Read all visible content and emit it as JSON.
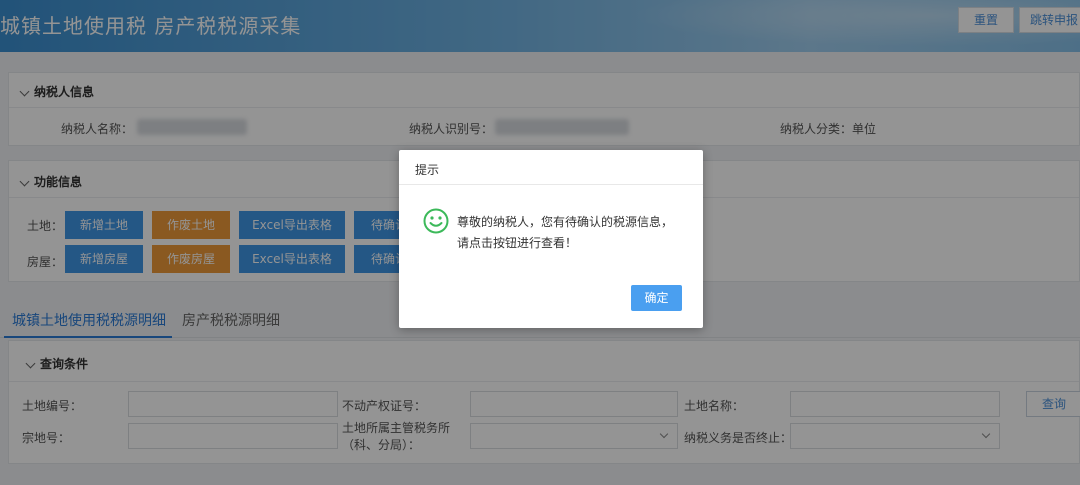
{
  "header": {
    "title": "城镇土地使用税 房产税税源采集",
    "reset_label": "重置",
    "transfer_label": "跳转申报"
  },
  "taxpayer": {
    "section_title": "纳税人信息",
    "name_label": "纳税人名称：",
    "id_label": "纳税人识别号：",
    "category_label": "纳税人分类：单位"
  },
  "functions": {
    "section_title": "功能信息",
    "land_label": "土地：",
    "house_label": "房屋：",
    "land_buttons": [
      "新增土地",
      "作废土地",
      "Excel导出表格",
      "待确认"
    ],
    "house_buttons": [
      "新增房屋",
      "作废房屋",
      "Excel导出表格",
      "待确认"
    ]
  },
  "tabs": [
    "城镇土地使用税税源明细",
    "房产税税源明细"
  ],
  "query": {
    "section_title": "查询条件",
    "land_no_label": "土地编号：",
    "cert_label": "不动产权证号：",
    "land_name_label": "土地名称：",
    "parcel_label": "宗地号：",
    "tax_office_label_1": "土地所属主管税务所",
    "tax_office_label_2": "（科、分局）：",
    "terminated_label": "纳税义务是否终止：",
    "search_label": "查询"
  },
  "dialog": {
    "title": "提示",
    "message_line1": "尊敬的纳税人，您有待确认的税源信息，",
    "message_line2": "请点击按钮进行查看！",
    "ok_label": "确定"
  },
  "colors": {
    "primary_blue": "#3f96e6",
    "orange": "#ee9a3a",
    "smiley_green": "#3cb95a"
  }
}
